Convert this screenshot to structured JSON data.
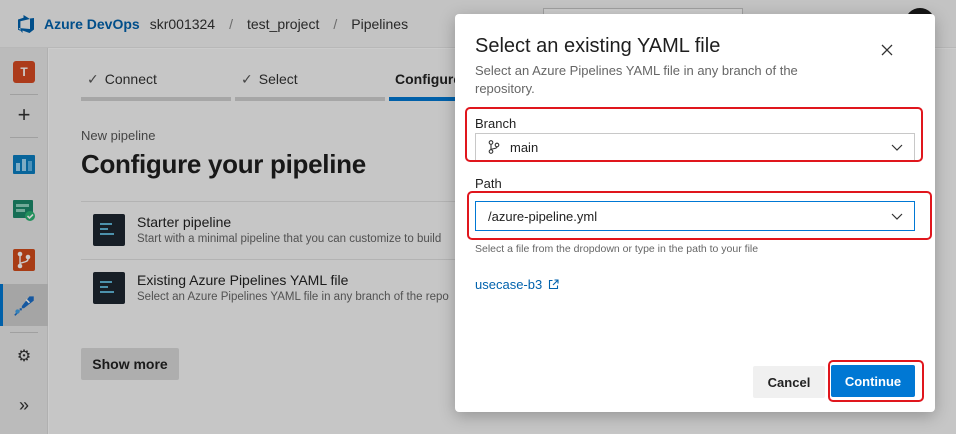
{
  "topbar": {
    "brand": "Azure DevOps",
    "org": "skr001324",
    "project": "test_project",
    "section": "Pipelines",
    "separator": "/"
  },
  "rail": {
    "project_initial": "T",
    "add_glyph": "+",
    "expand_glyph": "»",
    "icons": [
      "azure-devops-logo",
      "plus-icon",
      "boards-icon",
      "test-plans-icon",
      "repos-icon",
      "pipelines-icon",
      "gear-icon",
      "double-chevron-right-icon"
    ]
  },
  "wizard": {
    "steps": [
      {
        "label": "Connect",
        "done": true
      },
      {
        "label": "Select",
        "done": true
      },
      {
        "label": "Configure",
        "done": false
      }
    ],
    "check_glyph": "✓",
    "kicker": "New pipeline",
    "title": "Configure your pipeline",
    "options": [
      {
        "title": "Starter pipeline",
        "description": "Start with a minimal pipeline that you can customize to build"
      },
      {
        "title": "Existing Azure Pipelines YAML file",
        "description": "Select an Azure Pipelines YAML file in any branch of the repo"
      }
    ],
    "show_more": "Show more"
  },
  "dialog": {
    "title": "Select an existing YAML file",
    "subtitle": "Select an Azure Pipelines YAML file in any branch of the repository.",
    "branch_label": "Branch",
    "branch_value": "main",
    "path_label": "Path",
    "path_value": "/azure-pipeline.yml",
    "hint": "Select a file from the dropdown or type in the path to your file",
    "repo_link": "usecase-b3",
    "cancel": "Cancel",
    "continue": "Continue"
  },
  "colors": {
    "accent": "#0078d4",
    "annotation": "#e0161d",
    "brand": "#0062ad"
  }
}
